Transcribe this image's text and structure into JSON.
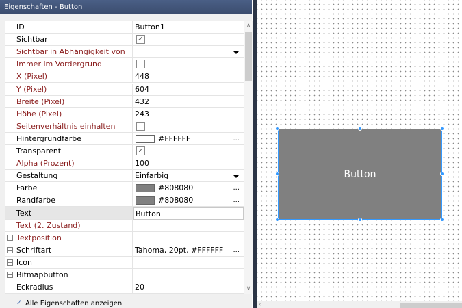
{
  "panel": {
    "title": "Eigenschaften - Button",
    "show_all_label": "Alle Eigenschaften anzeigen",
    "show_all_checked": true
  },
  "properties": [
    {
      "name": "ID",
      "value": "Button1",
      "type": "text"
    },
    {
      "name": "Sichtbar",
      "value": "",
      "type": "checkbox",
      "checked": true
    },
    {
      "name": "Sichtbar in Abhängigkeit von",
      "value": "",
      "type": "dropdown",
      "dependent": true
    },
    {
      "name": "Immer im Vordergrund",
      "value": "",
      "type": "checkbox",
      "checked": false,
      "dependent": true
    },
    {
      "name": "X (Pixel)",
      "value": "448",
      "type": "text",
      "dependent": true
    },
    {
      "name": "Y (Pixel)",
      "value": "604",
      "type": "text",
      "dependent": true
    },
    {
      "name": "Breite (Pixel)",
      "value": "432",
      "type": "text",
      "dependent": true
    },
    {
      "name": "Höhe (Pixel)",
      "value": "243",
      "type": "text",
      "dependent": true
    },
    {
      "name": "Seitenverhältnis einhalten",
      "value": "",
      "type": "checkbox",
      "checked": false,
      "dependent": true
    },
    {
      "name": "Hintergrundfarbe",
      "value": "#FFFFFF",
      "type": "color",
      "color": "#FFFFFF"
    },
    {
      "name": "Transparent",
      "value": "",
      "type": "checkbox",
      "checked": true
    },
    {
      "name": "Alpha (Prozent)",
      "value": "100",
      "type": "text",
      "dependent": true
    },
    {
      "name": "Gestaltung",
      "value": "Einfarbig",
      "type": "dropdown"
    },
    {
      "name": "Farbe",
      "value": "#808080",
      "type": "color",
      "color": "#808080"
    },
    {
      "name": "Randfarbe",
      "value": "#808080",
      "type": "color",
      "color": "#808080"
    },
    {
      "name": "Text",
      "value": "Button",
      "type": "text",
      "selected": true
    },
    {
      "name": "Text (2. Zustand)",
      "value": "",
      "type": "text",
      "dependent": true
    },
    {
      "name": "Textposition",
      "value": "",
      "type": "group",
      "dependent": true
    },
    {
      "name": "Schriftart",
      "value": "Tahoma, 20pt, #FFFFFF",
      "type": "group-ellipsis"
    },
    {
      "name": "Icon",
      "value": "",
      "type": "group"
    },
    {
      "name": "Bitmapbutton",
      "value": "",
      "type": "group"
    },
    {
      "name": "Eckradius",
      "value": "20",
      "type": "text"
    }
  ],
  "canvas": {
    "button_label": "Button",
    "button_color": "#808080",
    "selection_color": "#3399ff"
  },
  "glyphs": {
    "check": "✓",
    "expand": "+",
    "ellipsis": "...",
    "scroll_up": "∧",
    "scroll_down": "∨",
    "scroll_left": "‹"
  }
}
